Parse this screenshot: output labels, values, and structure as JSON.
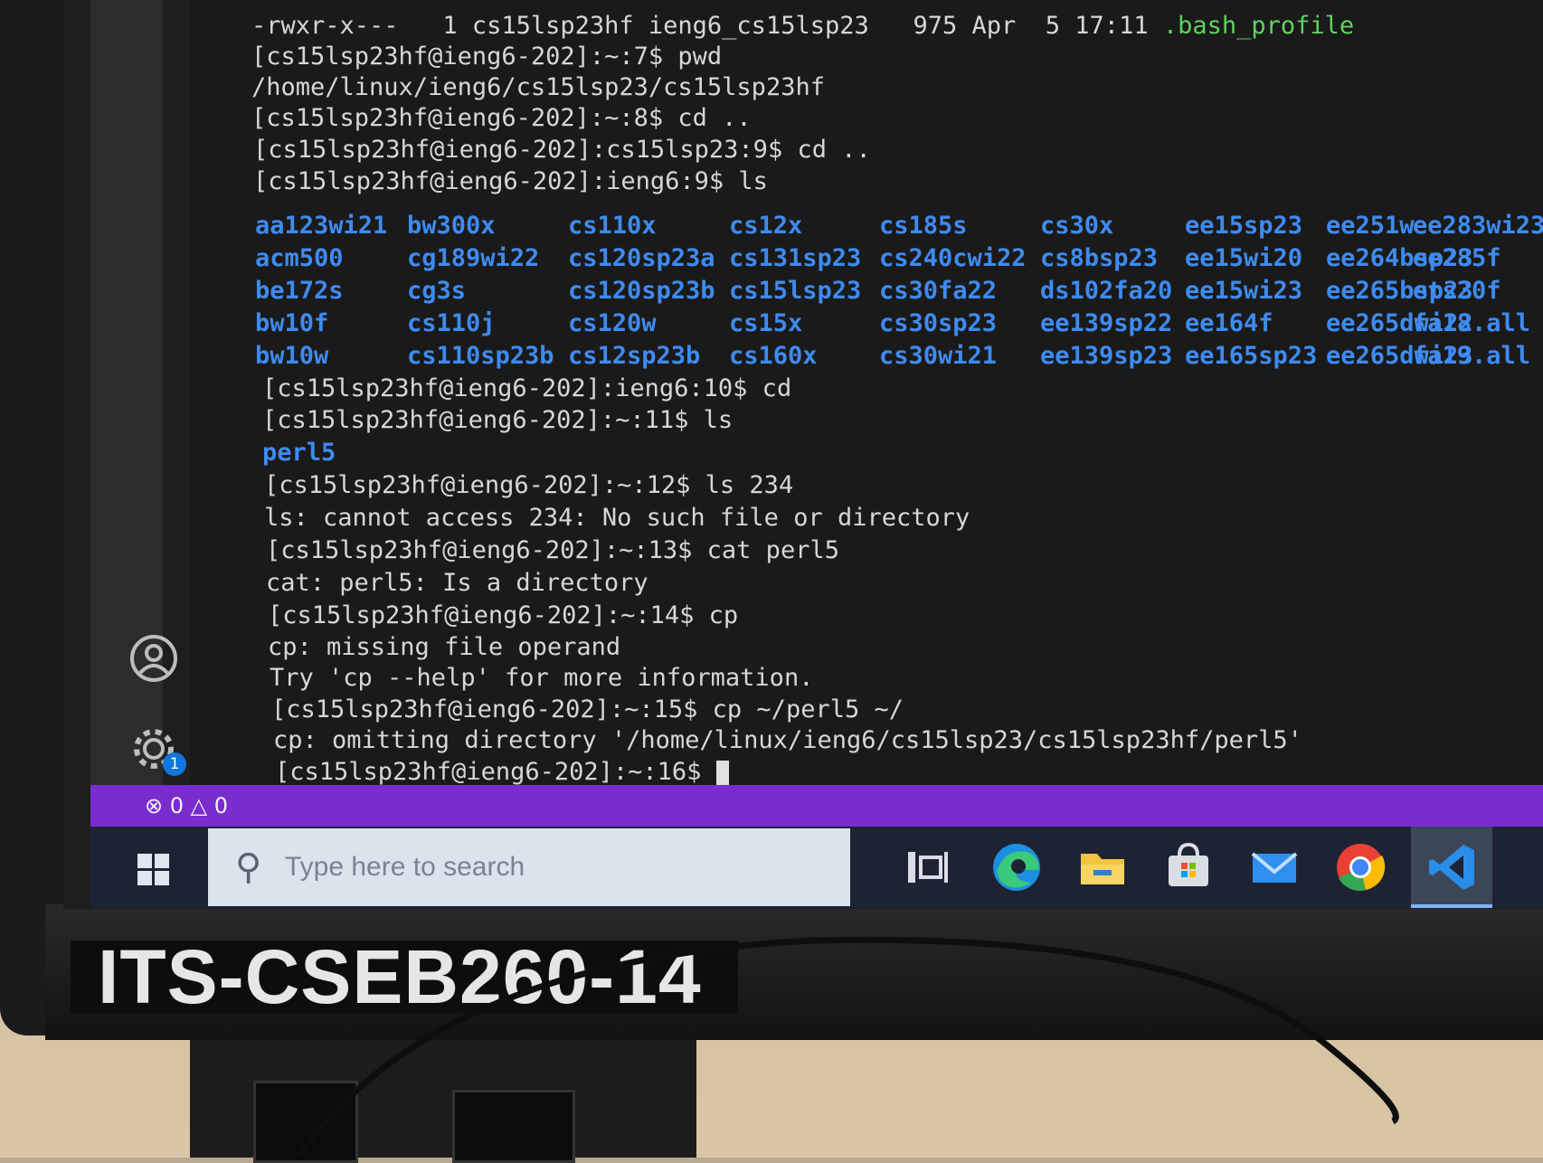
{
  "terminal": {
    "lines": {
      "l0": "-rwxr-x---   1 cs15lsp23hf ieng6_cs15lsp23   975 Apr  5 17:11 ",
      "l0_file": ".bash_profile",
      "l1": "[cs15lsp23hf@ieng6-202]:~:7$ pwd",
      "l2": "/home/linux/ieng6/cs15lsp23/cs15lsp23hf",
      "l3": "[cs15lsp23hf@ieng6-202]:~:8$ cd ..",
      "l4": "[cs15lsp23hf@ieng6-202]:cs15lsp23:9$ cd ..",
      "l5": "[cs15lsp23hf@ieng6-202]:ieng6:9$ ls",
      "l6": "[cs15lsp23hf@ieng6-202]:ieng6:10$ cd",
      "l7": "[cs15lsp23hf@ieng6-202]:~:11$ ls",
      "l8": "perl5",
      "l9": "[cs15lsp23hf@ieng6-202]:~:12$ ls 234",
      "l10": "ls: cannot access 234: No such file or directory",
      "l11": "[cs15lsp23hf@ieng6-202]:~:13$ cat perl5",
      "l12": "cat: perl5: Is a directory",
      "l13": "[cs15lsp23hf@ieng6-202]:~:14$ cp",
      "l14": "cp: missing file operand",
      "l15": "Try 'cp --help' for more information.",
      "l16": "[cs15lsp23hf@ieng6-202]:~:15$ cp ~/perl5 ~/",
      "l17": "cp: omitting directory '/home/linux/ieng6/cs15lsp23/cs15lsp23hf/perl5'",
      "l18": "[cs15lsp23hf@ieng6-202]:~:16$ "
    },
    "ls_columns": [
      [
        "aa123wi21",
        "acm500",
        "be172s",
        "bw10f",
        "bw10w"
      ],
      [
        "bw300x",
        "cg189wi22",
        "cg3s",
        "cs110j",
        "cs110sp23b"
      ],
      [
        "cs110x",
        "cs120sp23a",
        "cs120sp23b",
        "cs120w",
        "cs12sp23b"
      ],
      [
        "cs12x",
        "cs131sp23",
        "cs15lsp23",
        "cs15x",
        "cs160x"
      ],
      [
        "cs185s",
        "cs240cwi22",
        "cs30fa22",
        "cs30sp23",
        "cs30wi21"
      ],
      [
        "cs30x",
        "cs8bsp23",
        "ds102fa20",
        "ee139sp22",
        "ee139sp23"
      ],
      [
        "ee15sp23",
        "ee15wi20",
        "ee15wi23",
        "ee164f",
        "ee165sp23"
      ],
      [
        "ee251w",
        "ee264bsp23",
        "ee265bsp23",
        "ee265dwi22",
        "ee265dwi23"
      ],
      [
        "ee283wi23",
        "ee285f",
        "ets20f",
        "fa18.all",
        "fa19.all"
      ]
    ],
    "colors": {
      "prompt": "#d7d7d7",
      "directory": "#3e8bf1",
      "exec_file": "#5fd35f"
    }
  },
  "statusbar": {
    "errors": "0",
    "warnings": "0",
    "color": "#7a2ccf"
  },
  "activity_bar": {
    "icons": [
      "account-icon",
      "settings-gear-icon"
    ],
    "settings_badge": "1"
  },
  "taskbar": {
    "search_placeholder": "Type here to search",
    "pinned": [
      "task-view-icon",
      "edge-icon",
      "file-explorer-icon",
      "microsoft-store-icon",
      "mail-icon",
      "chrome-icon",
      "vscode-icon"
    ]
  },
  "monitor": {
    "asset_label": "ITS-CSEB260-14"
  }
}
